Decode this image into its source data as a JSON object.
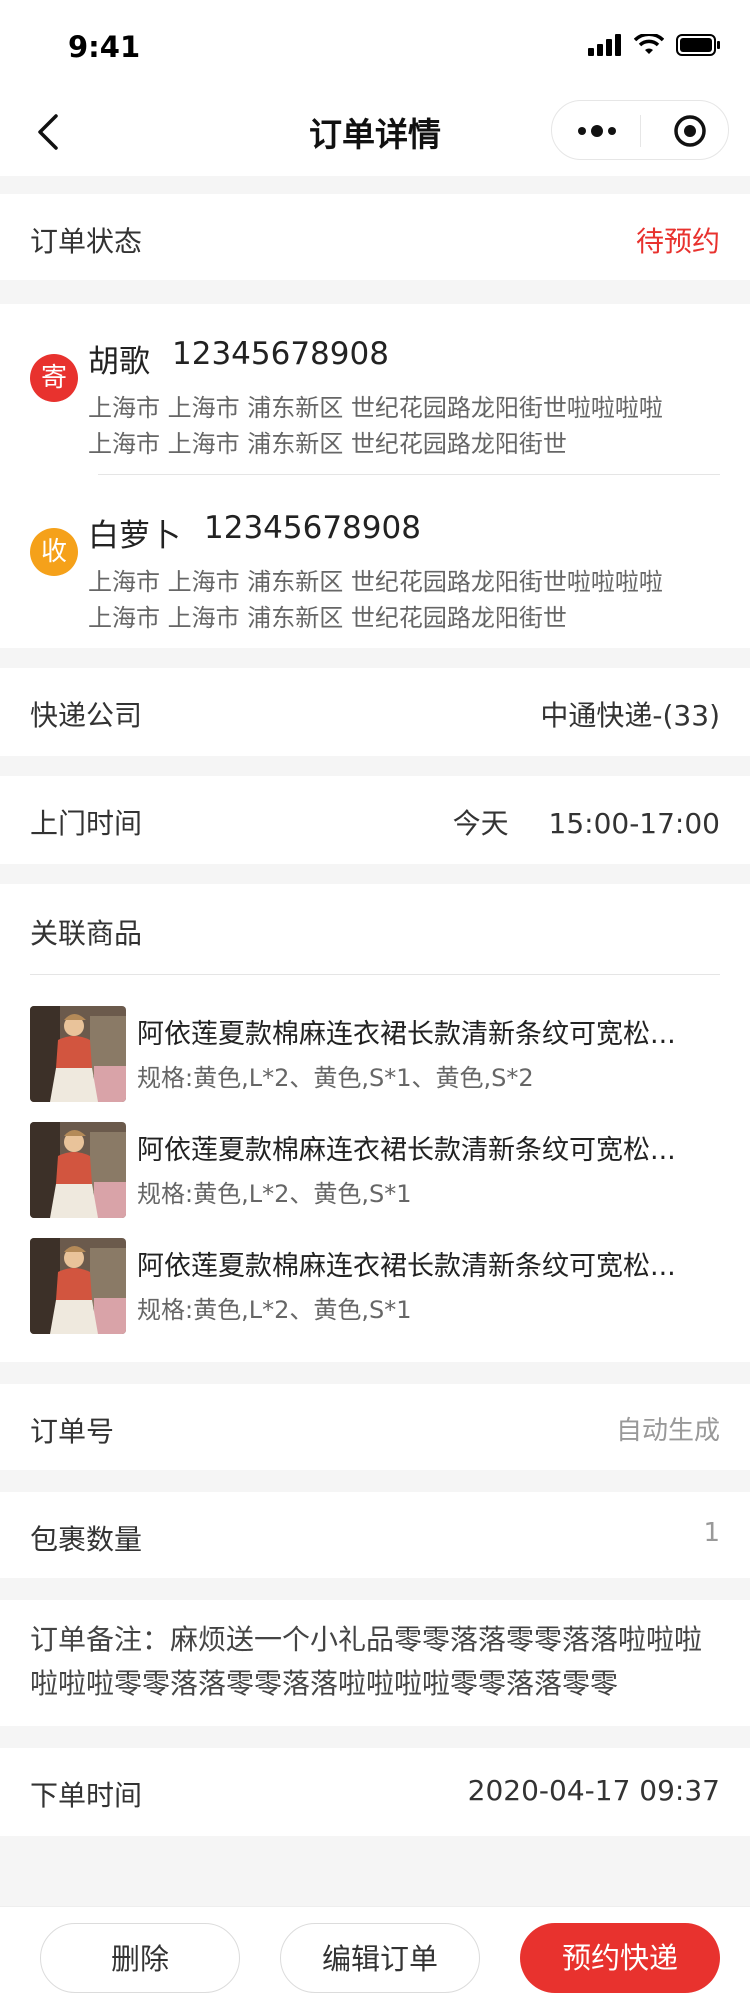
{
  "status_bar": {
    "time": "9:41"
  },
  "navbar": {
    "title": "订单详情"
  },
  "order_status": {
    "label": "订单状态",
    "value": "待预约",
    "value_color": "#e8322e"
  },
  "sender": {
    "badge": "寄",
    "badge_color": "#e8322e",
    "name": "胡歌",
    "phone": "12345678908",
    "address_line1": "上海市 上海市 浦东新区 世纪花园路龙阳街世啦啦啦啦",
    "address_line2": "上海市 上海市 浦东新区 世纪花园路龙阳街世"
  },
  "receiver": {
    "badge": "收",
    "badge_color": "#f5a11a",
    "name": "白萝卜",
    "phone": "12345678908",
    "address_line1": "上海市 上海市 浦东新区 世纪花园路龙阳街世啦啦啦啦",
    "address_line2": "上海市 上海市 浦东新区 世纪花园路龙阳街世"
  },
  "courier": {
    "label": "快递公司",
    "value": "中通快递-(33)"
  },
  "pickup_time": {
    "label": "上门时间",
    "day": "今天",
    "range": "15:00-17:00"
  },
  "products": {
    "label": "关联商品",
    "items": [
      {
        "title": "阿依莲夏款棉麻连衣裙长款清新条纹可宽松...",
        "spec": "规格:黄色,L*2、黄色,S*1、黄色,S*2"
      },
      {
        "title": "阿依莲夏款棉麻连衣裙长款清新条纹可宽松...",
        "spec": "规格:黄色,L*2、黄色,S*1"
      },
      {
        "title": "阿依莲夏款棉麻连衣裙长款清新条纹可宽松...",
        "spec": "规格:黄色,L*2、黄色,S*1"
      }
    ]
  },
  "order_no": {
    "label": "订单号",
    "value": "自动生成"
  },
  "package_count": {
    "label": "包裹数量",
    "value": "1"
  },
  "remark": {
    "label": "订单备注：",
    "text": "麻烦送一个小礼品零零落落零零落落啦啦啦啦啦啦零零落落零零落落啦啦啦啦零零落落零零"
  },
  "order_time": {
    "label": "下单时间",
    "value": "2020-04-17 09:37"
  },
  "actions": {
    "delete": "删除",
    "edit": "编辑订单",
    "book": "预约快递"
  },
  "colors": {
    "accent": "#e8322e",
    "background": "#f5f5f5"
  }
}
